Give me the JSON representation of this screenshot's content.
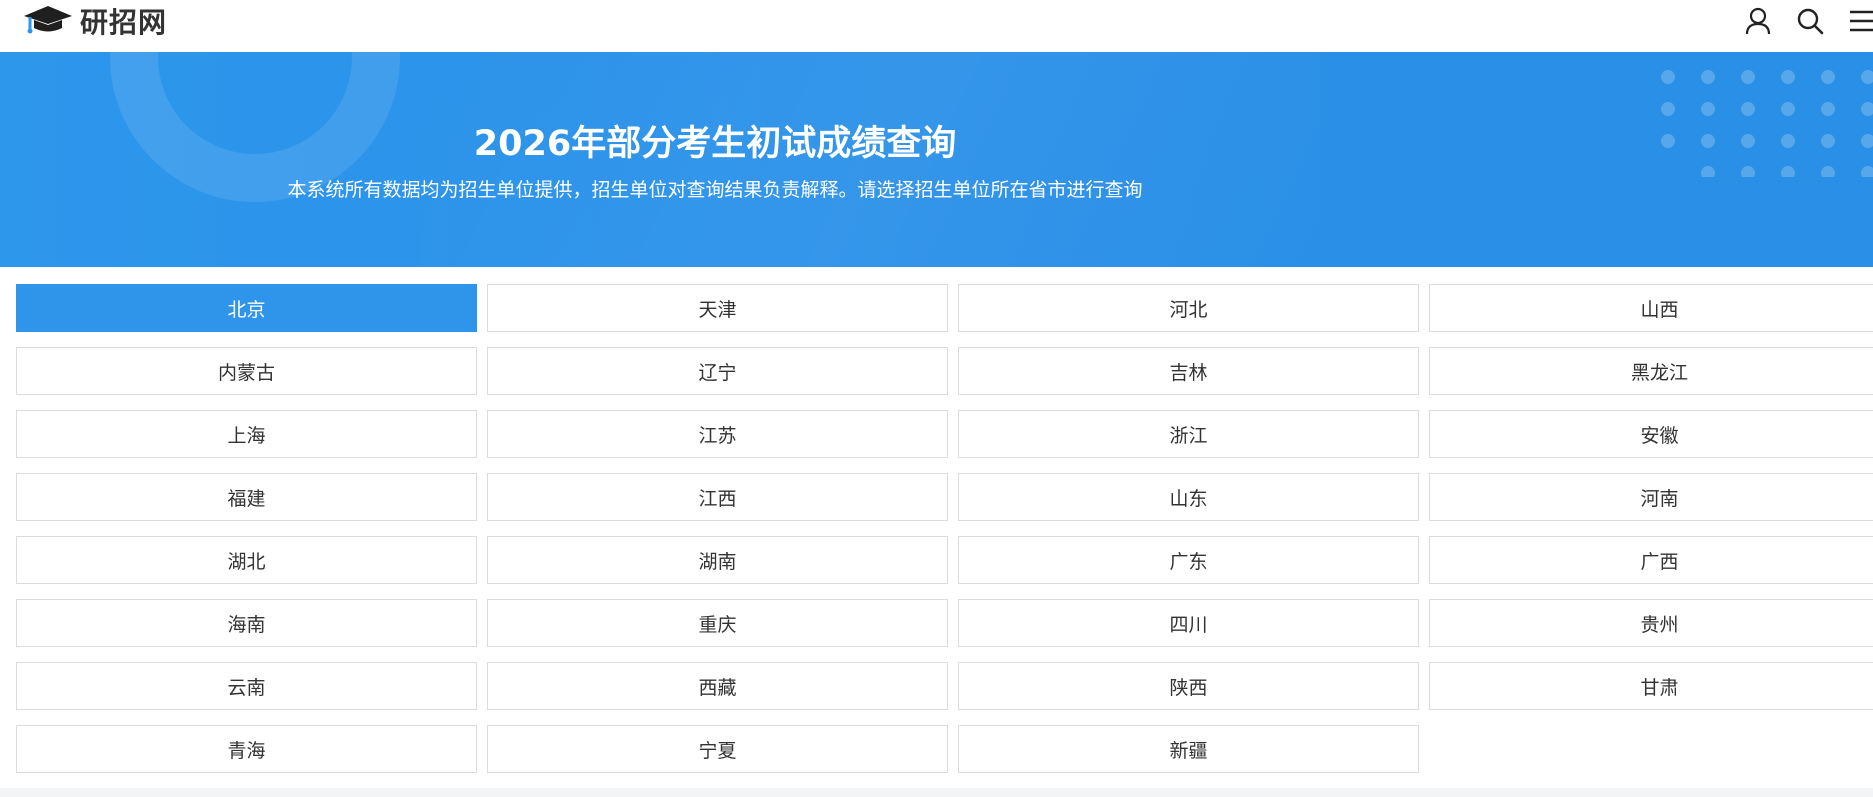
{
  "header": {
    "logo_text": "研招网",
    "icons": [
      "user-icon",
      "search-icon",
      "menu-icon"
    ]
  },
  "banner": {
    "title": "2026年部分考生初试成绩查询",
    "subtitle": "本系统所有数据均为招生单位提供，招生单位对查询结果负责解释。请选择招生单位所在省市进行查询"
  },
  "colors": {
    "accent": "#2f95ea",
    "banner": "#2a90e8",
    "text": "#333333",
    "border": "#dcdcdc"
  },
  "provinces": [
    {
      "label": "北京",
      "active": true
    },
    {
      "label": "天津"
    },
    {
      "label": "河北"
    },
    {
      "label": "山西"
    },
    {
      "label": "内蒙古"
    },
    {
      "label": "辽宁"
    },
    {
      "label": "吉林"
    },
    {
      "label": "黑龙江"
    },
    {
      "label": "上海"
    },
    {
      "label": "江苏"
    },
    {
      "label": "浙江"
    },
    {
      "label": "安徽"
    },
    {
      "label": "福建"
    },
    {
      "label": "江西"
    },
    {
      "label": "山东"
    },
    {
      "label": "河南"
    },
    {
      "label": "湖北"
    },
    {
      "label": "湖南"
    },
    {
      "label": "广东"
    },
    {
      "label": "广西"
    },
    {
      "label": "海南"
    },
    {
      "label": "重庆"
    },
    {
      "label": "四川"
    },
    {
      "label": "贵州"
    },
    {
      "label": "云南"
    },
    {
      "label": "西藏"
    },
    {
      "label": "陕西"
    },
    {
      "label": "甘肃"
    },
    {
      "label": "青海"
    },
    {
      "label": "宁夏"
    },
    {
      "label": "新疆"
    }
  ]
}
